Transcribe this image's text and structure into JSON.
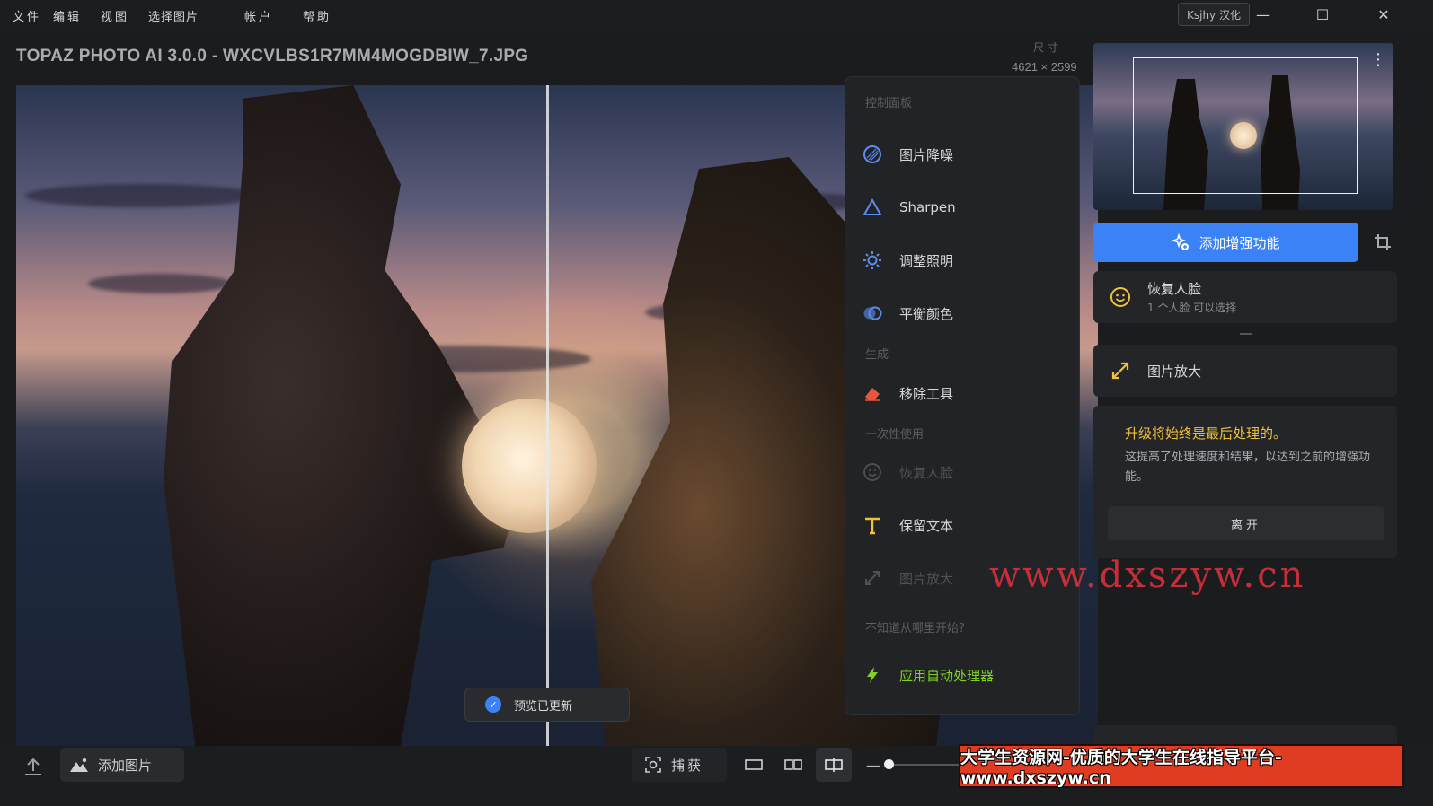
{
  "menubar": {
    "items": [
      "文件",
      "编辑",
      "视图",
      "选择图片",
      "帐户",
      "帮助"
    ],
    "badge": "Ksjhy 汉化",
    "minimize": "—",
    "maximize": "☐",
    "close": "✕"
  },
  "header": {
    "title": "TOPAZ PHOTO AI 3.0.0 - WXCVLBS1R7MM4MOGDBIW_7.JPG",
    "dimension_label": "尺寸",
    "dimension_value": "4621 × 2599"
  },
  "preview": {
    "status": "预览已更新"
  },
  "control_panel": {
    "section_control": "控制面板",
    "items_control": [
      {
        "label": "图片降噪",
        "icon": "denoise-icon",
        "color": "#5b8def"
      },
      {
        "label": "Sharpen",
        "icon": "triangle-icon",
        "color": "#5b8def"
      },
      {
        "label": "调整照明",
        "icon": "sun-icon",
        "color": "#5b8def"
      },
      {
        "label": "平衡颜色",
        "icon": "color-balance-icon",
        "color": "#5b8def"
      }
    ],
    "section_generate": "生成",
    "items_generate": [
      {
        "label": "移除工具",
        "icon": "eraser-icon",
        "color": "#e8563e"
      }
    ],
    "section_once": "一次性使用",
    "items_once": [
      {
        "label": "恢复人脸",
        "icon": "face-icon",
        "disabled": true
      },
      {
        "label": "保留文本",
        "icon": "text-icon",
        "color": "#f0c23b"
      },
      {
        "label": "图片放大",
        "icon": "upscale-icon",
        "disabled": true
      }
    ],
    "section_start": "不知道从哪里开始?",
    "autopilot": {
      "label": "应用自动处理器",
      "icon": "lightning-icon",
      "color": "#7ed321"
    }
  },
  "sidebar": {
    "enhance_button": "添加增强功能",
    "face_card": {
      "title": "恢复人脸",
      "subtitle": "1 个人脸 可以选择"
    },
    "upscale_card": {
      "title": "图片放大"
    },
    "notice": {
      "title": "升级将始终是最后处理的。",
      "body": "这提高了处理速度和结果，以达到之前的增强功能。",
      "button": "离开"
    }
  },
  "watermark": "www.dxszyw.cn",
  "bottombar": {
    "add_image": "添加图片",
    "capture": "捕获",
    "banner": "大学生资源网-优质的大学生在线指导平台-www.dxszyw.cn"
  },
  "colors": {
    "accent": "#3b82f6",
    "warning": "#f0c23b",
    "watermark": "#d8313c"
  }
}
